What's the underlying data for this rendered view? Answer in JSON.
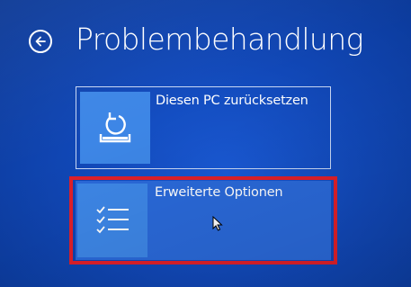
{
  "header": {
    "title": "Problembehandlung"
  },
  "tiles": [
    {
      "label": "Diesen PC zurücksetzen",
      "icon": "reset-pc-icon"
    },
    {
      "label": "Erweiterte Optionen",
      "icon": "checklist-icon",
      "highlighted": true
    }
  ],
  "colors": {
    "background": "#1148b8",
    "tile_icon_bg": "#3d86e6",
    "tile_selected_bg": "#2a69d9",
    "highlight_frame": "#e0202a"
  }
}
